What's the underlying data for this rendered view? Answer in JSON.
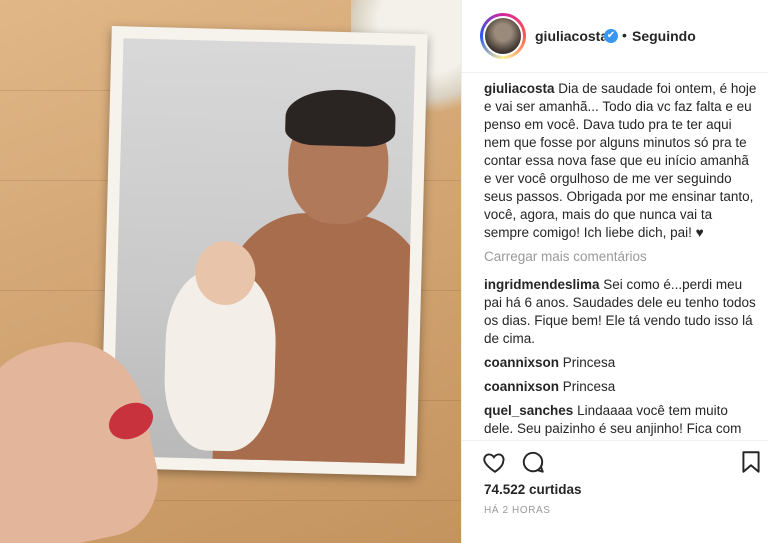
{
  "post": {
    "username": "giuliacosta",
    "follow_status": "Seguindo",
    "separator": "•",
    "verified_glyph": "✔"
  },
  "caption": {
    "username": "giuliacosta",
    "text": "Dia de saudade foi ontem, é hoje e vai ser amanhã... Todo dia vc faz falta e eu penso em você. Dava tudo pra te ter aqui nem que fosse por alguns minutos só pra te contar essa nova fase que eu início amanhã e ver você orgulhoso de me ver seguindo seus passos. Obrigada por me ensinar tanto, você, agora, mais do que nunca vai ta sempre comigo! Ich liebe dich, pai! ♥"
  },
  "load_more": "Carregar mais comentários",
  "comments": [
    {
      "username": "ingridmendeslima",
      "text": "Sei como é...perdi meu pai há 6 anos. Saudades dele eu tenho todos os dias. Fique bem! Ele tá vendo tudo isso lá de cima."
    },
    {
      "username": "coannixson",
      "text": "Princesa"
    },
    {
      "username": "coannixson",
      "text": "Princesa"
    },
    {
      "username": "quel_sanches",
      "text": "Lindaaaa você tem muito dele. Seu paizinho é seu anjinho! Fica com"
    }
  ],
  "likes_text": "74.522 curtidas",
  "timestamp": "HÁ 2 HORAS",
  "icons": {
    "like": "heart-icon",
    "comment": "comment-icon",
    "save": "bookmark-icon"
  },
  "colors": {
    "verified": "#3897f0",
    "text": "#262626",
    "muted": "#999999"
  }
}
